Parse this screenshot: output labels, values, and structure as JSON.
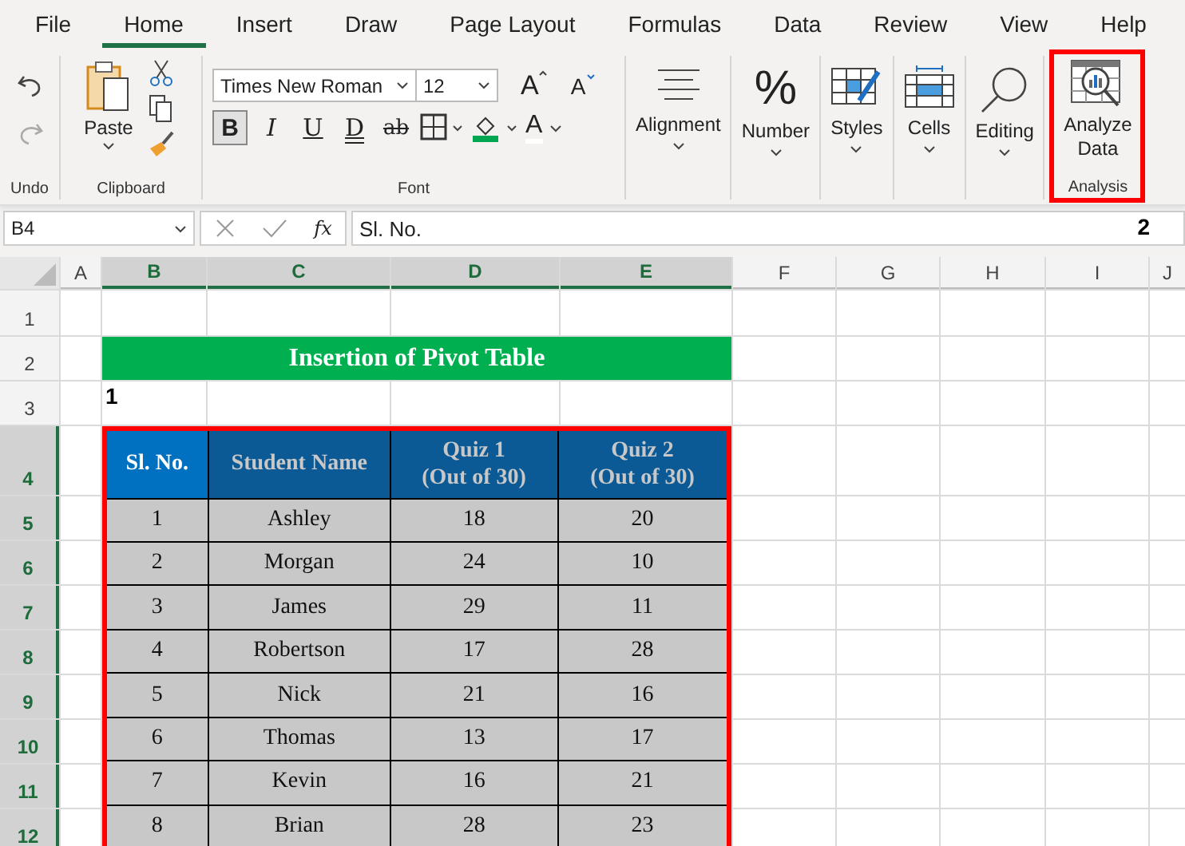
{
  "tabs": [
    {
      "label": "File",
      "selected": false
    },
    {
      "label": "Home",
      "selected": true
    },
    {
      "label": "Insert",
      "selected": false
    },
    {
      "label": "Draw",
      "selected": false
    },
    {
      "label": "Page Layout",
      "selected": false
    },
    {
      "label": "Formulas",
      "selected": false
    },
    {
      "label": "Data",
      "selected": false
    },
    {
      "label": "Review",
      "selected": false
    },
    {
      "label": "View",
      "selected": false
    },
    {
      "label": "Help",
      "selected": false
    }
  ],
  "ribbon": {
    "undo": {
      "label": "Undo"
    },
    "clipboard": {
      "label": "Clipboard",
      "paste": "Paste"
    },
    "font": {
      "label": "Font",
      "name": "Times New Roman",
      "size": "12",
      "grow": "A",
      "shrink": "A",
      "font_color": "A",
      "styles": [
        {
          "text": "B",
          "kind": "bold",
          "selected": true
        },
        {
          "text": "I",
          "kind": "italic",
          "selected": false
        },
        {
          "text": "U",
          "kind": "underline",
          "selected": false
        },
        {
          "text": "D",
          "kind": "double",
          "selected": false
        },
        {
          "text": "ab",
          "kind": "strike",
          "selected": false
        }
      ]
    },
    "groups": [
      {
        "label": "Alignment",
        "kind": "alignment"
      },
      {
        "label": "Number",
        "kind": "number",
        "glyph": "%"
      },
      {
        "label": "Styles",
        "kind": "styles"
      },
      {
        "label": "Cells",
        "kind": "cells"
      },
      {
        "label": "Editing",
        "kind": "editing"
      }
    ],
    "analysis": {
      "button": "Analyze Data",
      "label": "Analysis",
      "highlighted": true,
      "marker": "2"
    }
  },
  "formula_bar": {
    "name_box": "B4",
    "fx": "fx",
    "formula": "Sl. No."
  },
  "columns": [
    {
      "label": "A",
      "selected": false
    },
    {
      "label": "B",
      "selected": true
    },
    {
      "label": "C",
      "selected": true
    },
    {
      "label": "D",
      "selected": true
    },
    {
      "label": "E",
      "selected": true
    },
    {
      "label": "F",
      "selected": false
    },
    {
      "label": "G",
      "selected": false
    },
    {
      "label": "H",
      "selected": false
    },
    {
      "label": "I",
      "selected": false
    },
    {
      "label": "J",
      "selected": false
    }
  ],
  "rows": [
    {
      "label": "1",
      "selected": false
    },
    {
      "label": "2",
      "selected": false
    },
    {
      "label": "3",
      "selected": false
    },
    {
      "label": "4",
      "selected": true
    },
    {
      "label": "5",
      "selected": true
    },
    {
      "label": "6",
      "selected": true
    },
    {
      "label": "7",
      "selected": true
    },
    {
      "label": "8",
      "selected": true
    },
    {
      "label": "9",
      "selected": true
    },
    {
      "label": "10",
      "selected": true
    },
    {
      "label": "11",
      "selected": true
    },
    {
      "label": "12",
      "selected": true
    }
  ],
  "sheet": {
    "title": "Insertion of Pivot Table",
    "marker": "1",
    "table": {
      "highlighted": true,
      "headers": [
        {
          "text": "Sl. No.",
          "selected": true
        },
        {
          "text": "Student Name",
          "selected": false
        },
        {
          "text": "Quiz 1\n(Out of 30)",
          "selected": false
        },
        {
          "text": "Quiz 2\n(Out of 30)",
          "selected": false
        }
      ],
      "rows": [
        [
          "1",
          "Ashley",
          "18",
          "20"
        ],
        [
          "2",
          "Morgan",
          "24",
          "10"
        ],
        [
          "3",
          "James",
          "29",
          "11"
        ],
        [
          "4",
          "Robertson",
          "17",
          "28"
        ],
        [
          "5",
          "Nick",
          "21",
          "16"
        ],
        [
          "6",
          "Thomas",
          "13",
          "17"
        ],
        [
          "7",
          "Kevin",
          "16",
          "21"
        ],
        [
          "8",
          "Brian",
          "28",
          "23"
        ]
      ]
    }
  }
}
